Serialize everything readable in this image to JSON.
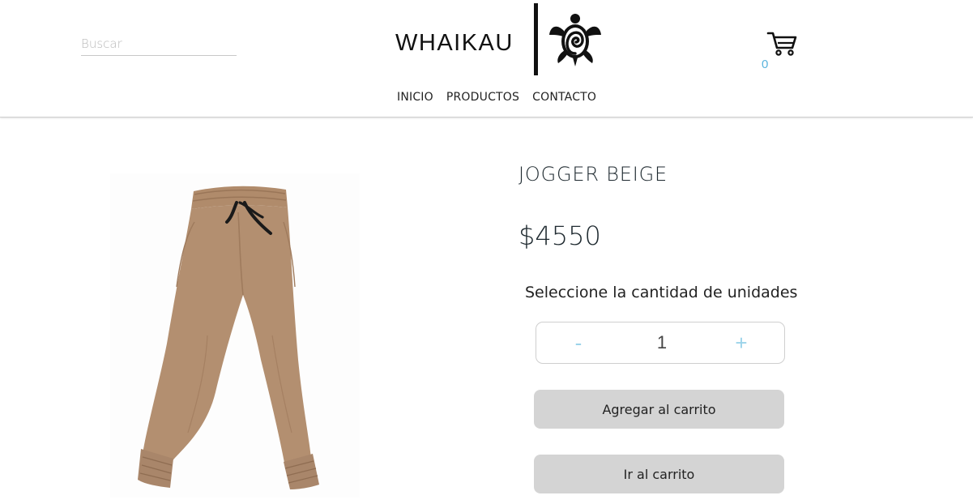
{
  "header": {
    "search": {
      "placeholder": "Buscar",
      "value": ""
    },
    "logo": {
      "text": "WHAIKAU",
      "icon": "turtle-icon"
    },
    "cart": {
      "icon": "cart-icon",
      "count": "0"
    },
    "nav": [
      {
        "label": "INICIO"
      },
      {
        "label": "PRODUCTOS"
      },
      {
        "label": "CONTACTO"
      }
    ]
  },
  "product": {
    "title": "JOGGER BEIGE",
    "price": "$4550",
    "quantity_label": "Seleccione la cantidad de unidades",
    "quantity": {
      "minus": "-",
      "value": "1",
      "plus": "+"
    },
    "add_to_cart_label": "Agregar al carrito",
    "go_to_cart_label": "Ir al carrito",
    "image_subject": "beige jogger pants"
  },
  "colors": {
    "accent_blue": "#5ab4dd",
    "stepper_blue": "#9bd3ea",
    "button_gray": "#d4d4d4",
    "product_beige": "#b38f70"
  }
}
